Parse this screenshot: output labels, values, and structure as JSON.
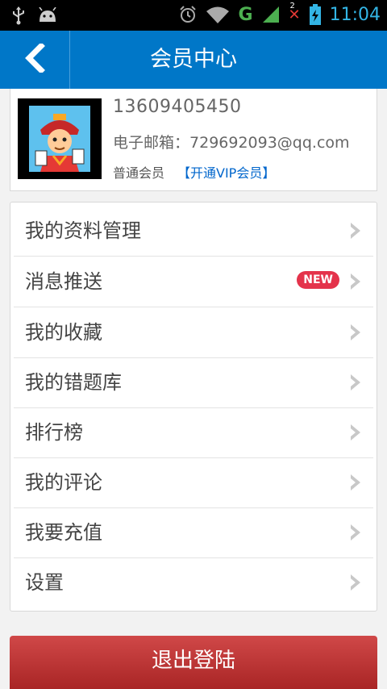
{
  "status_bar": {
    "time": "11:04",
    "network": "G",
    "sim_badge": "2"
  },
  "header": {
    "title": "会员中心"
  },
  "profile": {
    "phone": "13609405450",
    "email_label": "电子邮箱：",
    "email": "729692093@qq.com",
    "member_level": "普通会员",
    "vip_link": "【开通VIP会员】"
  },
  "menu": {
    "items": [
      {
        "label": "我的资料管理"
      },
      {
        "label": "消息推送",
        "badge": "NEW"
      },
      {
        "label": "我的收藏"
      },
      {
        "label": "我的错题库"
      },
      {
        "label": "排行榜"
      },
      {
        "label": "我的评论"
      },
      {
        "label": "我要充值"
      },
      {
        "label": "设置"
      }
    ]
  },
  "logout": {
    "label": "退出登陆"
  },
  "colors": {
    "header": "#0077c8",
    "logout": "#b83232",
    "badge": "#e4334b",
    "vip_link": "#0066cc"
  }
}
